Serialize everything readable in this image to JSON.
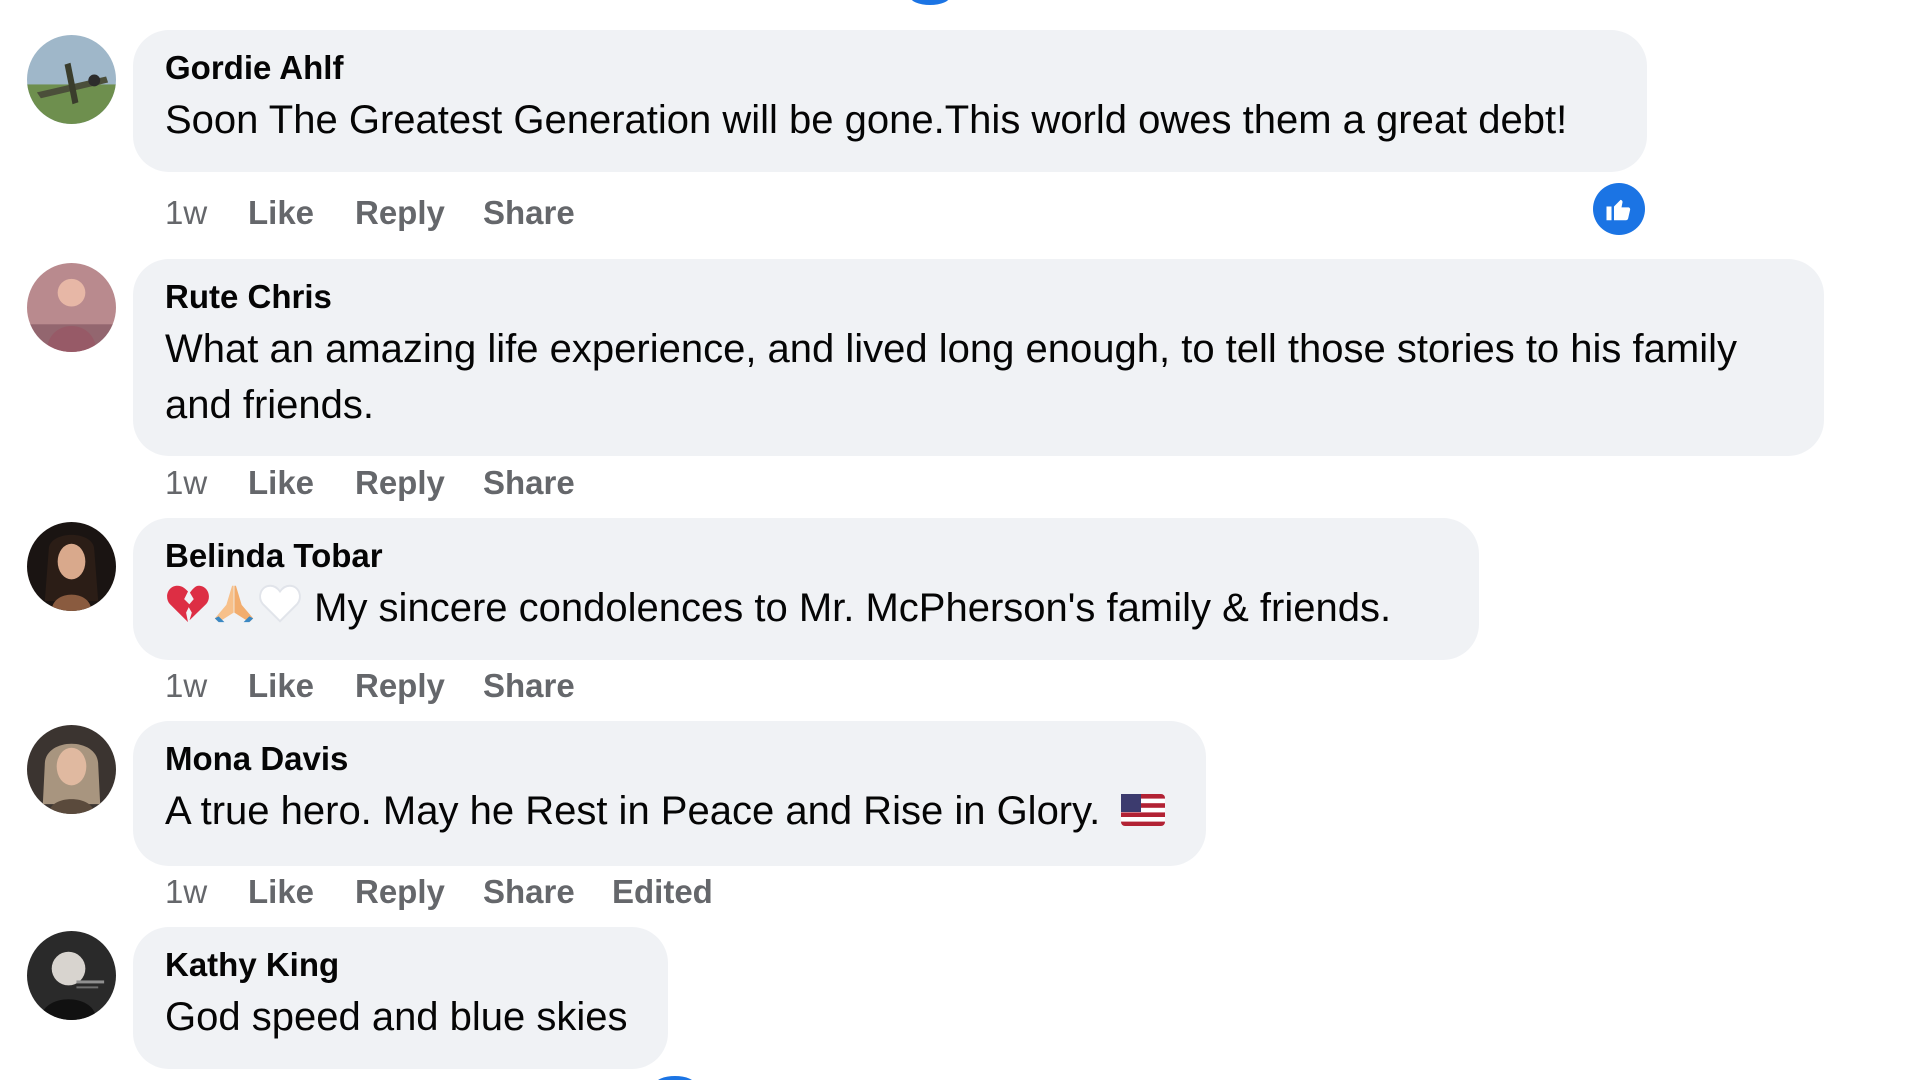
{
  "comments": [
    {
      "author": "Gordie Ahlf",
      "text": "Soon The Greatest Generation will be gone.This world owes them a great debt!",
      "time": "1w",
      "like": "Like",
      "reply": "Reply",
      "share": "Share",
      "avatar_icon": "airplane-avatar",
      "reaction_icon": "thumbs-up-icon"
    },
    {
      "author": "Rute Chris",
      "text": "What an amazing life experience, and lived long enough, to tell those stories to his family and friends.",
      "time": "1w",
      "like": "Like",
      "reply": "Reply",
      "share": "Share",
      "avatar_icon": "person-avatar"
    },
    {
      "author": "Belinda Tobar",
      "text": "My sincere condolences to Mr. McPherson's family & friends.",
      "emojis": [
        "broken-heart-icon",
        "folded-hands-icon",
        "white-heart-icon"
      ],
      "time": "1w",
      "like": "Like",
      "reply": "Reply",
      "share": "Share",
      "avatar_icon": "person-avatar"
    },
    {
      "author": "Mona Davis",
      "text": "A true hero. May he Rest in Peace and Rise in Glory.",
      "emojis": [
        "us-flag-icon"
      ],
      "time": "1w",
      "like": "Like",
      "reply": "Reply",
      "share": "Share",
      "edited": "Edited",
      "avatar_icon": "person-avatar"
    },
    {
      "author": "Kathy King",
      "text": "God speed and blue skies",
      "avatar_icon": "person-avatar"
    }
  ],
  "colors": {
    "bubble": "#f0f2f5",
    "meta_text": "#65676b",
    "accent": "#1b74e4"
  }
}
